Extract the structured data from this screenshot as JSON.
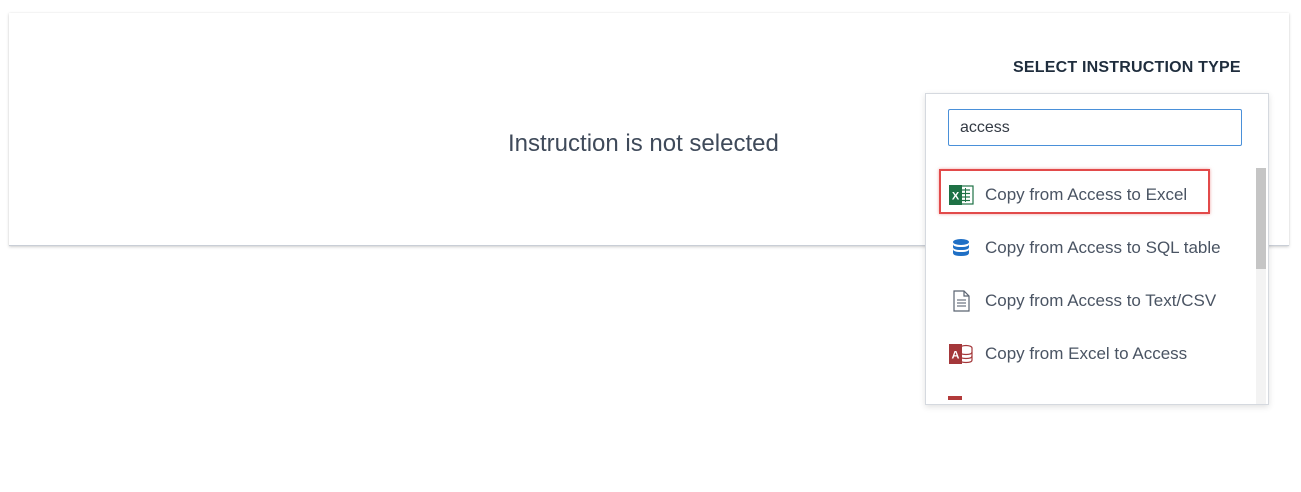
{
  "panel": {
    "empty_message": "Instruction is not selected",
    "select_label": "SELECT INSTRUCTION TYPE"
  },
  "dropdown": {
    "search_value": "access",
    "items": [
      {
        "label": "Copy from Access to Excel",
        "icon": "excel-icon",
        "highlighted": true
      },
      {
        "label": "Copy from Access to SQL table",
        "icon": "database-icon",
        "highlighted": false
      },
      {
        "label": "Copy from Access to Text/CSV",
        "icon": "text-file-icon",
        "highlighted": false
      },
      {
        "label": "Copy from Excel to Access",
        "icon": "access-icon",
        "highlighted": false
      }
    ]
  },
  "colors": {
    "excel": "#1e7145",
    "database": "#1f6fc5",
    "access": "#a4373a",
    "highlight_border": "#e24a4a",
    "search_border": "#4a90d9"
  }
}
